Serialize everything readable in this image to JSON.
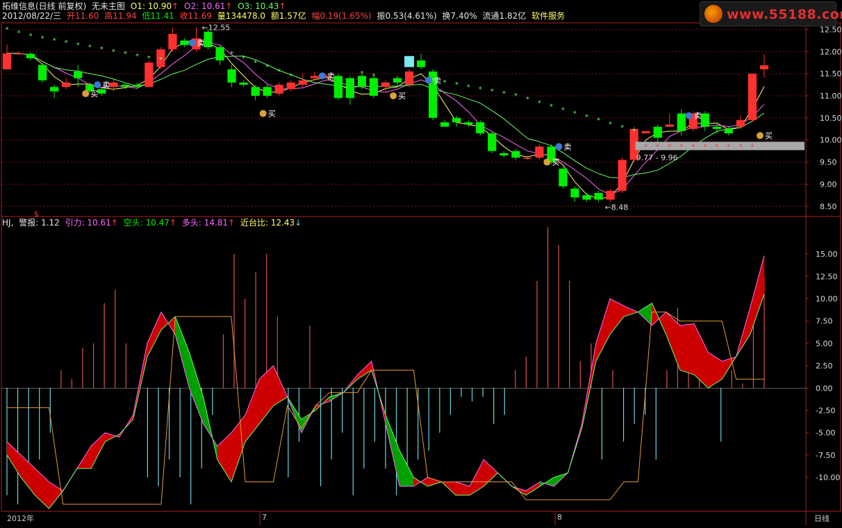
{
  "header": {
    "stock": "拓维信息(日线 前复权)",
    "main_chart": "无未主图",
    "o1": "O1: 10.90",
    "o2": "O2: 10.61",
    "o3": "O3: 10.43",
    "quote": [
      "2012/08/22/三",
      "开11.60",
      "高11.94",
      "低11.41",
      "收11.69",
      "量134478.0",
      "额1.57亿",
      "幅0.19(1.65%)",
      "振0.53(4.61%)",
      "换7.40%",
      "流通1.82亿",
      "软件服务"
    ]
  },
  "logo": {
    "text": "www.55188.com"
  },
  "indicator_header": {
    "name": "HJ,",
    "alert": "警报: 1.12",
    "pull": "引力: 10.61",
    "short": "空头: 10.47",
    "long": "多头: 14.81",
    "ratio": "近台比: 12.43"
  },
  "colors": {
    "up": "#ff3030",
    "down": "#00ee00",
    "grid": "#7a1010",
    "frame": "#b02020",
    "fast": "#ffff66",
    "mid": "#ff66ff",
    "slow": "#66ff66",
    "orange": "#e89a30",
    "cyan": "#6cd6e0"
  },
  "bottom_bar": {
    "labels": [
      "2012年",
      "7",
      "8"
    ],
    "mode": "日线"
  },
  "chart_data": [
    {
      "type": "candlestick",
      "y_ticks": [
        "12.50",
        "12.00",
        "11.50",
        "11.00",
        "10.50",
        "10.00",
        "9.50",
        "9.00",
        "8.50"
      ],
      "ylim": [
        8.3,
        12.65
      ],
      "annotations": {
        "high_label": "12.55",
        "low_label": "8.48",
        "band_label": "9.77 - 9.96"
      },
      "signals": {
        "buy": "买",
        "sell": "卖"
      },
      "candles": [
        [
          11.6,
          11.96,
          12.16,
          11.6
        ],
        [
          11.96,
          11.96,
          12.0,
          11.94
        ],
        [
          11.95,
          11.85,
          11.98,
          11.8
        ],
        [
          11.7,
          11.35,
          11.7,
          11.3
        ],
        [
          11.2,
          11.1,
          11.25,
          10.95
        ],
        [
          11.2,
          11.3,
          11.4,
          11.15
        ],
        [
          11.55,
          11.4,
          11.7,
          11.2
        ],
        [
          11.25,
          11.1,
          11.3,
          11.05
        ],
        [
          11.15,
          11.05,
          11.2,
          11.0
        ],
        [
          11.2,
          11.3,
          11.4,
          11.1
        ],
        [
          11.25,
          11.2,
          11.3,
          11.15
        ],
        [
          11.25,
          11.2,
          11.3,
          11.15
        ],
        [
          11.2,
          11.75,
          11.8,
          11.2
        ],
        [
          11.65,
          12.05,
          12.1,
          11.6
        ],
        [
          12.05,
          12.4,
          12.55,
          12.0
        ],
        [
          12.25,
          12.15,
          12.3,
          12.1
        ],
        [
          12.05,
          12.3,
          12.55,
          12.0
        ],
        [
          12.45,
          12.1,
          12.5,
          12.05
        ],
        [
          12.1,
          11.8,
          12.15,
          11.7
        ],
        [
          11.6,
          11.3,
          11.7,
          11.2
        ],
        [
          11.3,
          11.25,
          11.35,
          11.2
        ],
        [
          11.2,
          11.0,
          11.25,
          10.9
        ],
        [
          11.2,
          11.0,
          11.25,
          10.95
        ],
        [
          11.05,
          11.25,
          11.3,
          11.0
        ],
        [
          11.15,
          11.3,
          11.35,
          11.1
        ],
        [
          11.25,
          11.35,
          11.5,
          11.2
        ],
        [
          11.4,
          11.45,
          11.55,
          11.35
        ],
        [
          11.45,
          11.45,
          11.5,
          11.4
        ],
        [
          11.45,
          10.95,
          11.5,
          10.9
        ],
        [
          11.4,
          10.95,
          11.45,
          10.8
        ],
        [
          11.45,
          11.2,
          11.5,
          11.15
        ],
        [
          11.4,
          11.0,
          11.45,
          10.95
        ],
        [
          11.2,
          11.3,
          11.35,
          11.1
        ],
        [
          11.4,
          11.3,
          11.45,
          11.2
        ],
        [
          11.25,
          11.55,
          11.6,
          11.2
        ],
        [
          11.8,
          11.65,
          11.95,
          11.6
        ],
        [
          11.55,
          10.5,
          11.6,
          10.45
        ],
        [
          10.4,
          10.3,
          10.45,
          10.3
        ],
        [
          10.5,
          10.4,
          10.55,
          10.3
        ],
        [
          10.4,
          10.35,
          10.45,
          10.3
        ],
        [
          10.4,
          10.15,
          10.45,
          10.1
        ],
        [
          10.15,
          9.75,
          10.2,
          9.7
        ],
        [
          9.7,
          9.65,
          9.75,
          9.6
        ],
        [
          9.75,
          9.6,
          9.8,
          9.55
        ],
        [
          9.6,
          9.6,
          9.65,
          9.55
        ],
        [
          9.6,
          9.85,
          9.9,
          9.55
        ],
        [
          9.85,
          9.5,
          9.9,
          9.45
        ],
        [
          9.35,
          8.95,
          9.4,
          8.9
        ],
        [
          8.9,
          8.7,
          8.95,
          8.6
        ],
        [
          8.75,
          8.65,
          8.8,
          8.6
        ],
        [
          8.8,
          8.65,
          8.85,
          8.6
        ],
        [
          8.65,
          8.85,
          8.9,
          8.6
        ],
        [
          8.85,
          9.55,
          9.6,
          8.8
        ],
        [
          9.55,
          10.25,
          10.3,
          9.5
        ],
        [
          10.15,
          10.2,
          10.2,
          10.15
        ],
        [
          10.3,
          10.05,
          10.35,
          9.95
        ],
        [
          10.3,
          10.35,
          10.6,
          10.3
        ],
        [
          10.6,
          10.2,
          10.7,
          10.1
        ],
        [
          10.25,
          10.6,
          10.65,
          10.2
        ],
        [
          10.6,
          10.3,
          10.65,
          10.2
        ],
        [
          10.3,
          10.25,
          10.35,
          10.15
        ],
        [
          10.25,
          10.15,
          10.3,
          10.1
        ],
        [
          10.3,
          10.45,
          10.55,
          10.25
        ],
        [
          10.45,
          11.5,
          11.5,
          10.4
        ],
        [
          11.6,
          11.69,
          11.94,
          11.41
        ]
      ]
    },
    {
      "type": "area-line",
      "name": "HJ",
      "y_ticks": [
        "15.00",
        "12.50",
        "10.00",
        "7.50",
        "5.00",
        "2.50",
        "0.00",
        "-2.50",
        "-5.00",
        "-7.50",
        "-10.00"
      ],
      "ylim": [
        -13.8,
        17.8
      ],
      "upper": [
        -6,
        -7.5,
        -9,
        -10.5,
        -11.5,
        -9,
        -6.5,
        -5,
        -5.5,
        -3,
        5,
        8.5,
        6,
        0,
        -4,
        -6.5,
        -5,
        -3,
        1,
        2.5,
        -1,
        -5,
        -2,
        -1.5,
        -0.5,
        1.5,
        3,
        -4,
        -11,
        -11,
        -10,
        -10.5,
        -10.5,
        -11,
        -8,
        -9.5,
        -11,
        -11.5,
        -10.5,
        -11,
        -9.5,
        -4,
        5,
        10,
        9.2,
        8.5,
        7,
        8.5,
        7,
        7.2,
        4,
        3,
        3.5,
        9,
        14.8
      ],
      "lower": [
        -7.5,
        -10,
        -12,
        -13.5,
        -11.5,
        -9,
        -9,
        -6,
        -5.2,
        -3.5,
        3.5,
        6.5,
        8,
        4,
        -1,
        -8,
        -10.5,
        -6,
        -4,
        -2,
        -1,
        -3.5,
        -2.5,
        -1,
        -0.5,
        1,
        2,
        -3,
        -7,
        -10,
        -11,
        -10.5,
        -12,
        -12,
        -11,
        -9.5,
        -11,
        -12,
        -11,
        -10,
        -9.5,
        -4.5,
        3,
        6,
        8,
        8.5,
        9.5,
        6,
        2,
        1.5,
        0,
        1,
        3.5,
        6,
        10.5
      ],
      "orange_line": [
        -2.2,
        -2.2,
        -2.2,
        -2.2,
        -13,
        -13,
        -13,
        -13,
        -13,
        -13,
        -13,
        -13,
        8,
        8,
        8,
        8,
        8,
        -10.5,
        -10.5,
        -10.5,
        -2,
        -4.5,
        -2,
        -0.5,
        -0.5,
        -0.5,
        2,
        2,
        2,
        2,
        -10,
        -10.5,
        -10.5,
        -10.5,
        -10.5,
        -10.5,
        -10.5,
        -12.5,
        -12.5,
        -12.5,
        -12.5,
        -12.5,
        -12.5,
        -12.5,
        -10.5,
        -10.5,
        8.5,
        8.5,
        7.5,
        7.5,
        7.5,
        7.5,
        1,
        1,
        1
      ],
      "bars": [
        -12,
        -13,
        -11,
        -8,
        -5,
        2,
        1,
        4.5,
        5,
        9.5,
        11,
        5,
        0,
        -10,
        -11,
        -8,
        -10,
        -13,
        -9,
        -3,
        6,
        15,
        10,
        13,
        15,
        8,
        -10,
        -6,
        7,
        -11,
        -8,
        -5,
        -12,
        -9,
        -6,
        -9,
        -12,
        -11,
        -8,
        -7,
        -5,
        -3,
        -1,
        -1.5,
        -1,
        -4,
        -3,
        2,
        3.5,
        12,
        18,
        16,
        12,
        3,
        5,
        -8,
        2,
        -6,
        -4,
        -3,
        -8,
        2,
        9,
        7,
        4,
        1,
        -6,
        2,
        0.5,
        8,
        12.43
      ]
    }
  ]
}
